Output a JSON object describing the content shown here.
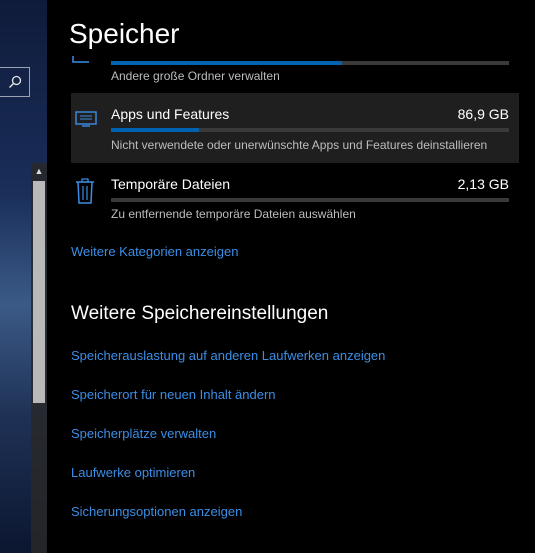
{
  "page": {
    "title": "Speicher"
  },
  "categories": [
    {
      "label": "",
      "size": "",
      "description": "Andere große Ordner verwalten",
      "fill": 0.58
    },
    {
      "label": "Apps und Features",
      "size": "86,9 GB",
      "description": "Nicht verwendete oder unerwünschte Apps und Features deinstallieren",
      "fill": 0.22
    },
    {
      "label": "Temporäre Dateien",
      "size": "2,13 GB",
      "description": "Zu entfernende temporäre Dateien auswählen",
      "fill": 0.0
    }
  ],
  "more_categories_link": "Weitere Kategorien anzeigen",
  "more_settings": {
    "title": "Weitere Speichereinstellungen",
    "links": [
      "Speicherauslastung auf anderen Laufwerken anzeigen",
      "Speicherort für neuen Inhalt ändern",
      "Speicherplätze verwalten",
      "Laufwerke optimieren",
      "Sicherungsoptionen anzeigen"
    ]
  },
  "colors": {
    "accent": "#0063b1",
    "link": "#3b8ee6",
    "background": "#000000",
    "selected_row": "#1f1f1f"
  },
  "icons": {
    "search": "search-icon",
    "apps": "apps-icon",
    "temp": "trash-icon",
    "other": "folder-icon"
  }
}
